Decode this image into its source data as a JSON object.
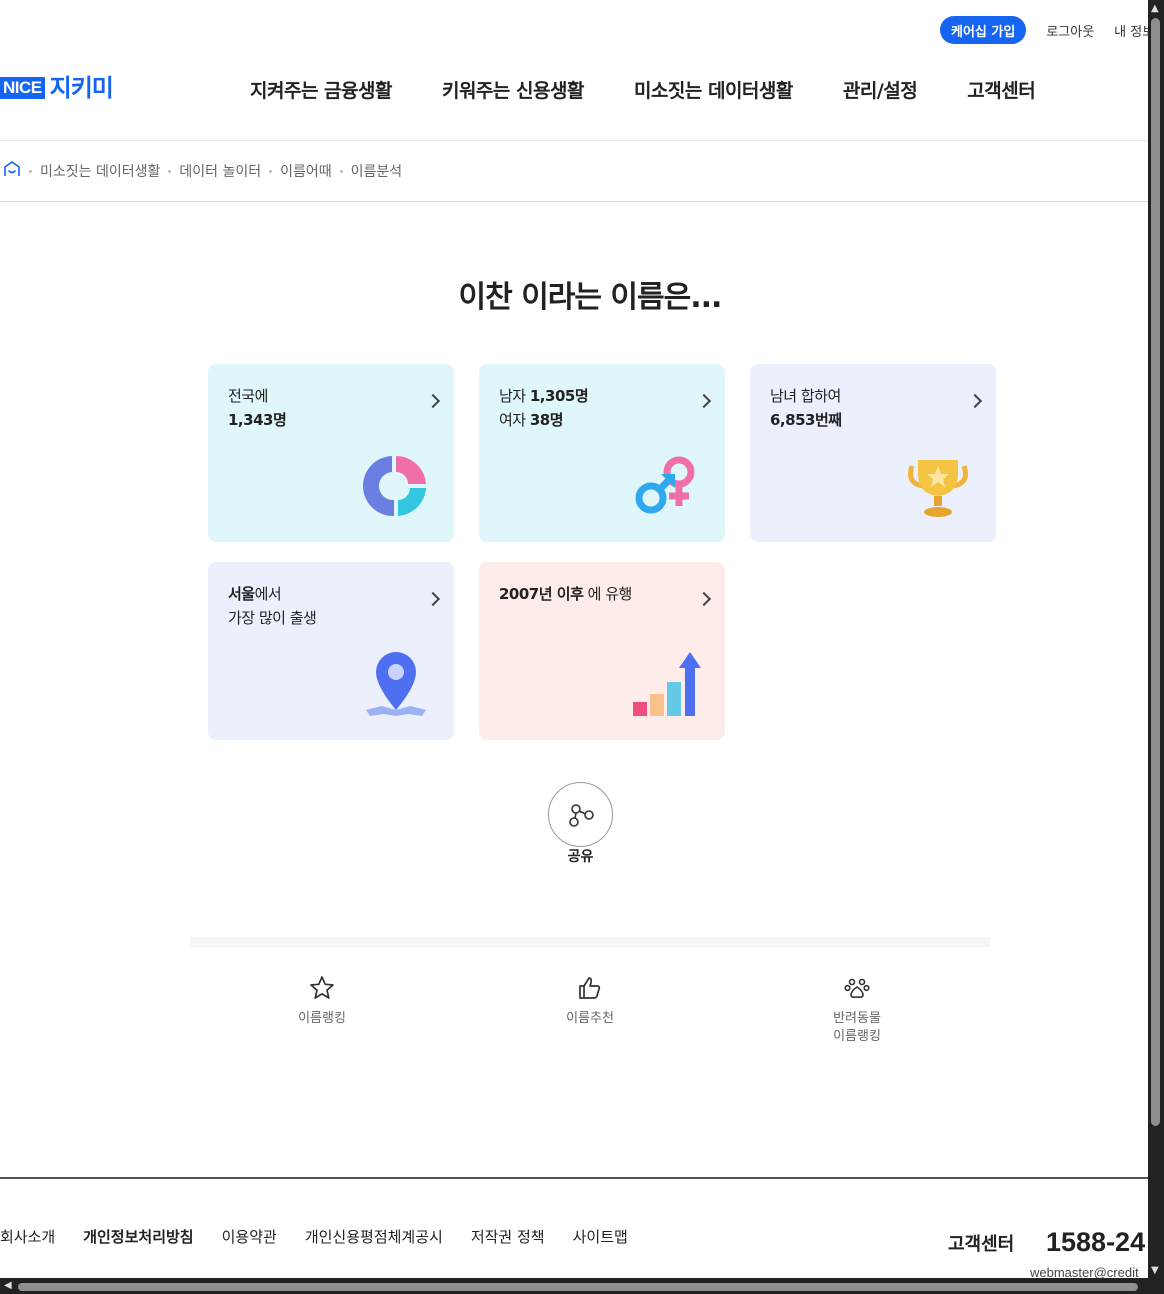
{
  "header": {
    "care_button": "케어십 가입",
    "logout": "로그아웃",
    "myinfo": "내 정보",
    "logo_nice": "NICE",
    "logo_text": "지키미",
    "nav": [
      "지켜주는 금융생활",
      "키워주는 신용생활",
      "미소짓는 데이터생활",
      "관리/설정",
      "고객센터"
    ]
  },
  "breadcrumb": [
    "미소짓는 데이터생활",
    "데이터 놀이터",
    "이름어때",
    "이름분석"
  ],
  "title": "이찬 이라는 이름은...",
  "cards": [
    {
      "l1a": "전국에",
      "l1b": "",
      "l2a": "1,343명",
      "l2b": ""
    },
    {
      "l1a": "남자 ",
      "l1b": "1,305명",
      "l2a": "여자 ",
      "l2b": "38명"
    },
    {
      "l1a": "남녀 합하여",
      "l1b": "",
      "l2a": "6,853번째",
      "l2b": ""
    },
    {
      "l1a": "서울",
      "l1b": "에서",
      "l2a": "가장 많이 출생",
      "l2b": ""
    },
    {
      "l1a": "2007년 이후",
      "l1b": " 에 유행",
      "l2a": "",
      "l2b": ""
    }
  ],
  "share_label": "공유",
  "quick_links": [
    {
      "label": "이름랭킹",
      "icon": "star-icon"
    },
    {
      "label": "이름추천",
      "icon": "thumbs-up-icon"
    },
    {
      "label": "반려동물\n이름랭킹",
      "icon": "paw-icon"
    }
  ],
  "footer": {
    "links": [
      "회사소개",
      "개인정보처리방침",
      "이용약관",
      "개인신용평점체계공시",
      "저작권 정책",
      "사이트맵"
    ],
    "cs_label": "고객센터",
    "phone": "1588-24",
    "email": "webmaster@credit"
  },
  "colors": {
    "brand": "#1565f0",
    "card_cyan": "#dff7fa",
    "card_lavender": "#ecf0fd",
    "card_pink": "#feeceb"
  }
}
